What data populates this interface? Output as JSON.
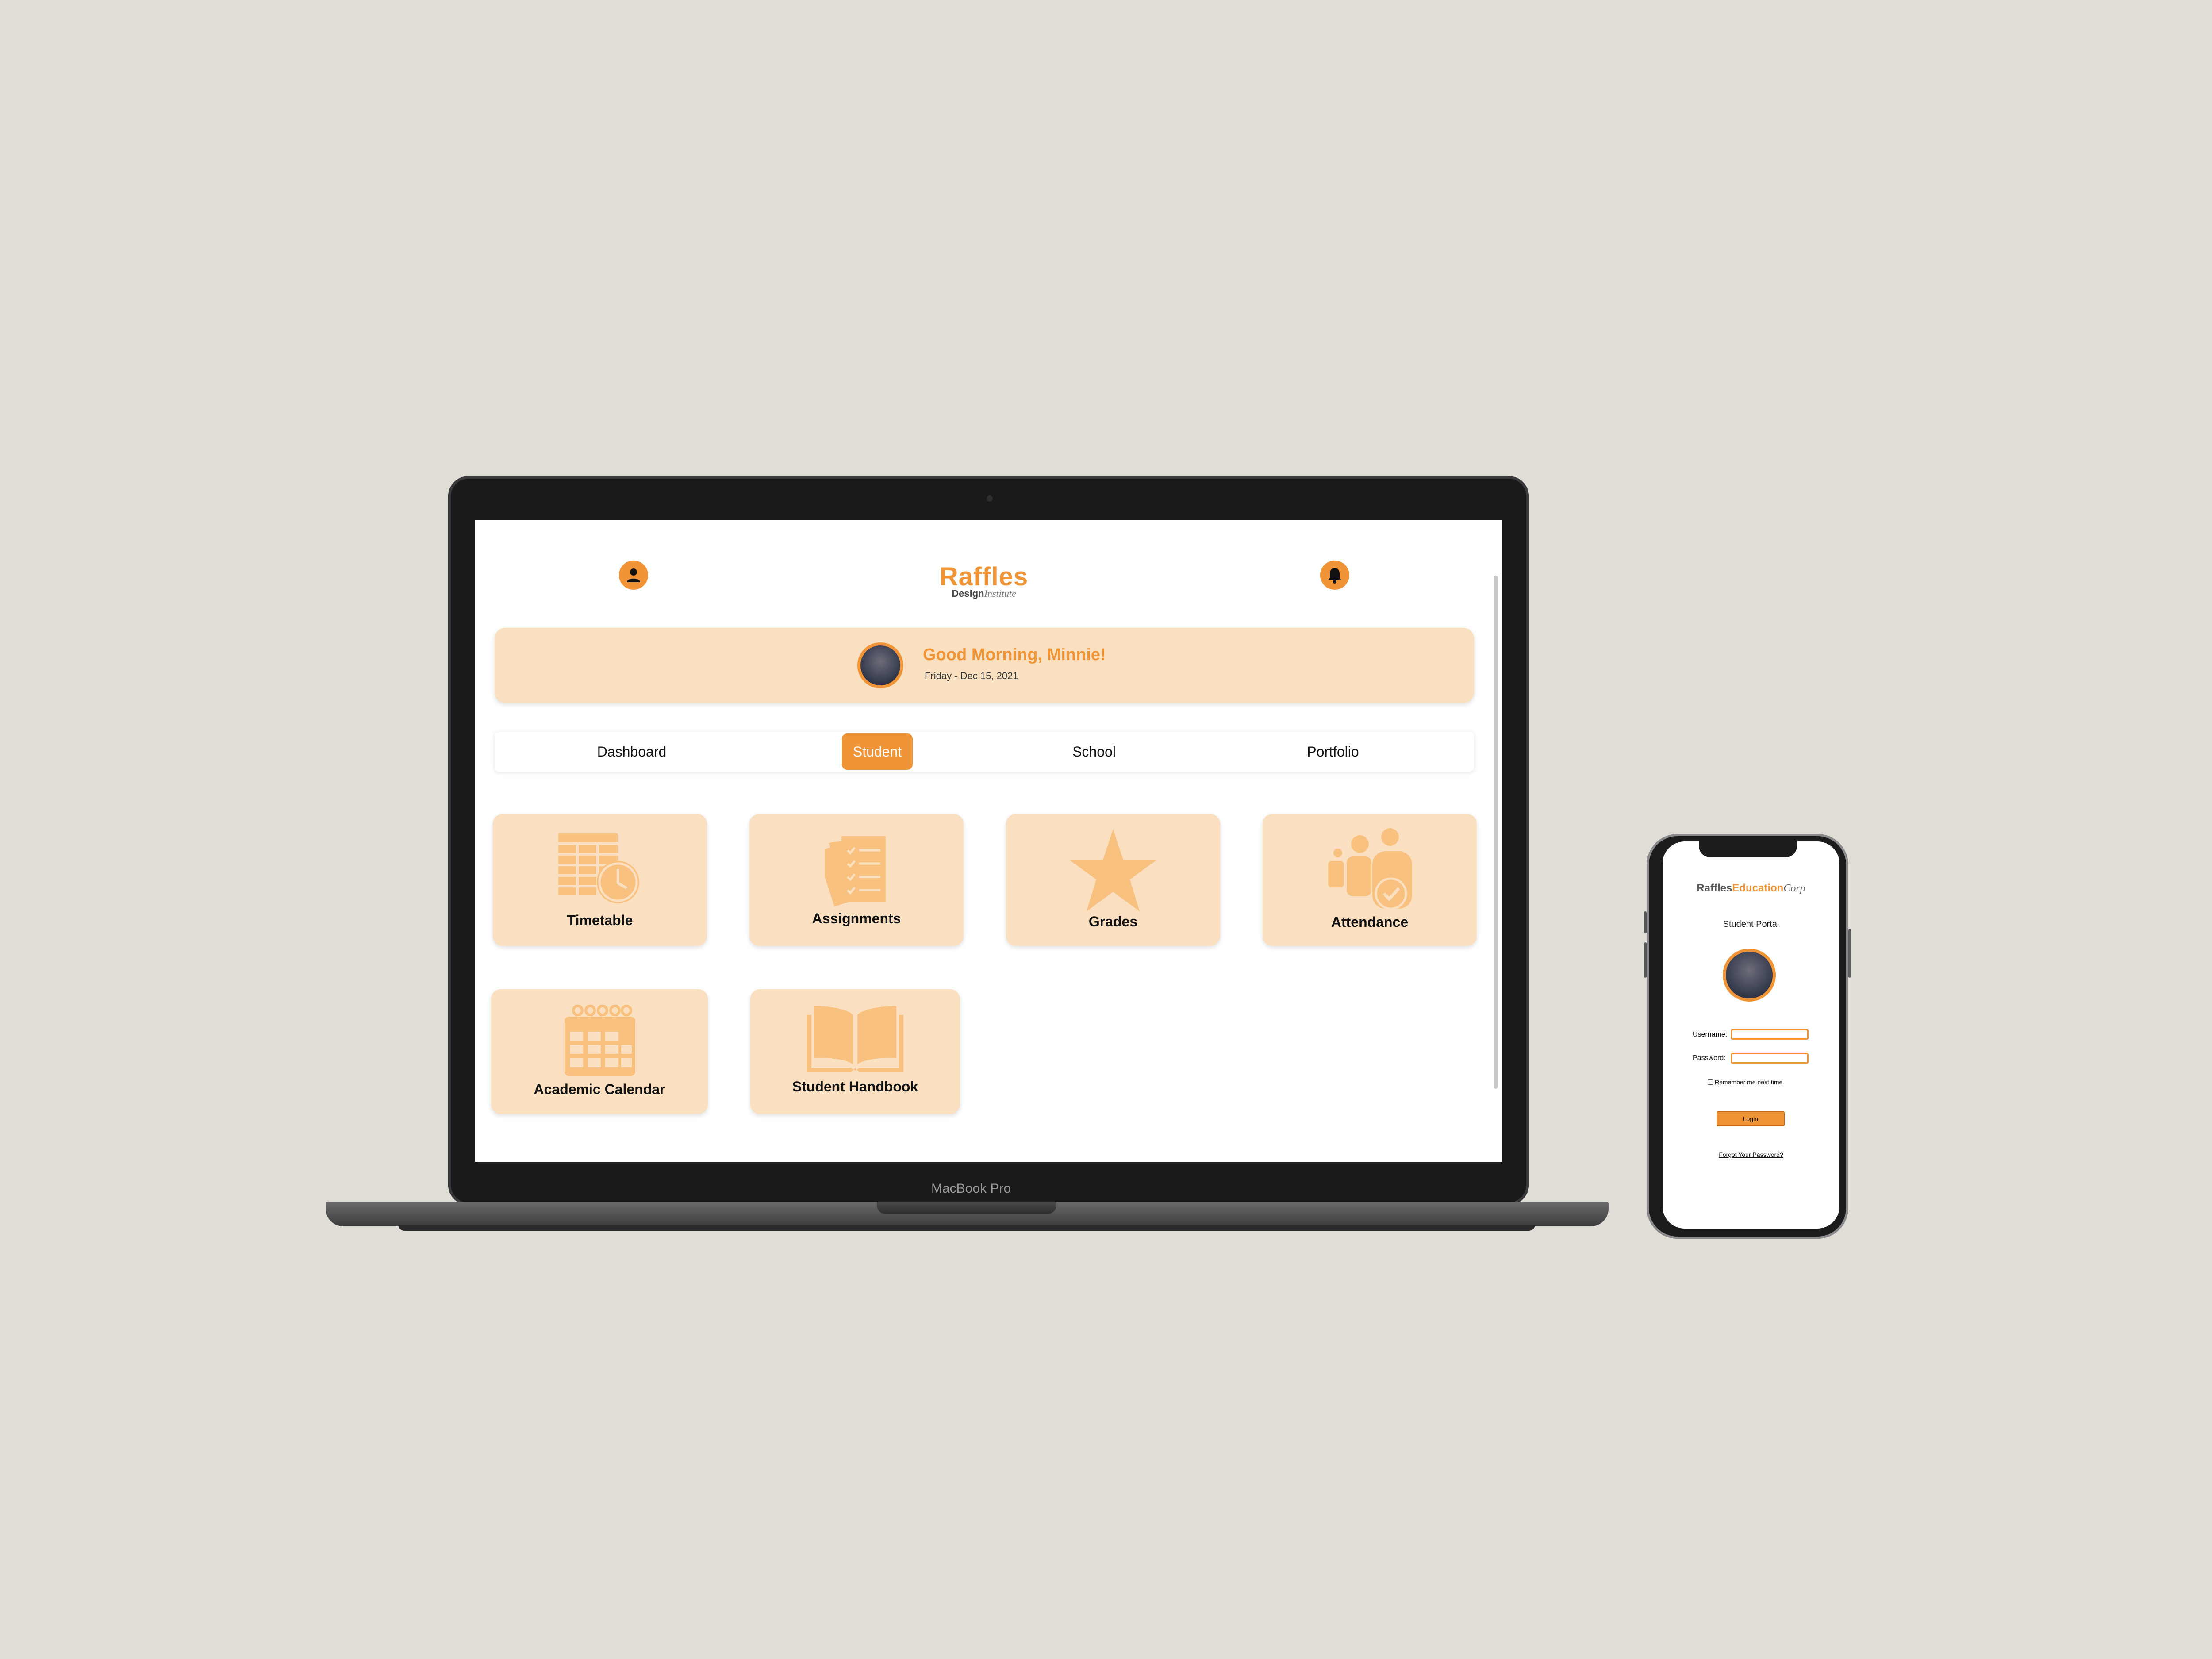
{
  "laptop": {
    "device_label": "MacBook Pro",
    "header": {
      "profile_icon": "user-icon",
      "notification_icon": "bell-icon",
      "logo_main": "Raffles",
      "logo_sub_bold": "Design",
      "logo_sub_italic": "Institute"
    },
    "greeting": {
      "title": "Good Morning, Minnie!",
      "date": "Friday - Dec 15, 2021"
    },
    "nav": {
      "tabs": [
        "Dashboard",
        "Student",
        "School",
        "Portfolio"
      ],
      "active": "Student"
    },
    "tiles": [
      {
        "label": "Timetable",
        "icon": "timetable-icon"
      },
      {
        "label": "Assignments",
        "icon": "assignments-icon"
      },
      {
        "label": "Grades",
        "icon": "star-icon"
      },
      {
        "label": "Attendance",
        "icon": "attendance-icon"
      },
      {
        "label": "Academic Calendar",
        "icon": "calendar-icon"
      },
      {
        "label": "Student Handbook",
        "icon": "book-icon"
      }
    ]
  },
  "phone": {
    "logo_part1": "Raffles",
    "logo_part2": "Education",
    "logo_part3": "Corp",
    "portal_title": "Student Portal",
    "username_label": "Username:",
    "password_label": "Password:",
    "remember_label": "Remember me next time",
    "login_label": "Login",
    "forgot_label": "Forgot Your Password?"
  },
  "colors": {
    "accent": "#f09438",
    "tile_bg": "#fae0c1",
    "icon_fill": "#f8c17f",
    "background": "#e0ddd6"
  }
}
